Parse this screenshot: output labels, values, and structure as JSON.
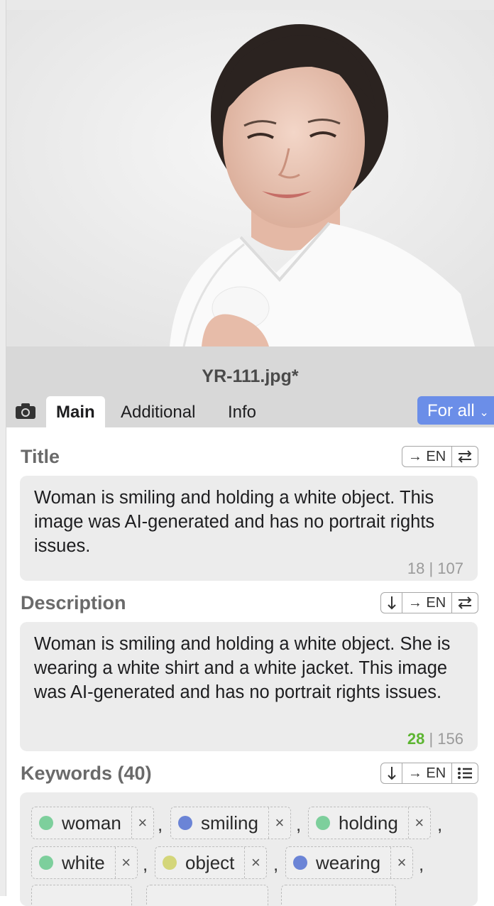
{
  "file": {
    "name": "YR-111.jpg*"
  },
  "tabs": {
    "camera_icon": "camera-icon",
    "main": "Main",
    "additional": "Additional",
    "info": "Info",
    "for_all": "For all"
  },
  "title_section": {
    "label": "Title",
    "translate_label": "→ EN",
    "swap_icon": "swap-icon",
    "text": "Woman is smiling and holding a white object. This image was AI-generated and has no portrait rights issues.",
    "count_used": "18",
    "separator": "|",
    "count_max": "107"
  },
  "description_section": {
    "label": "Description",
    "download_icon": "arrow-down-icon",
    "translate_label": "→ EN",
    "swap_icon": "swap-icon",
    "text": "Woman is smiling and holding a white object. She is wearing a white shirt and a white jacket. This image was AI-generated and has no portrait rights issues.",
    "count_used": "28",
    "separator": "|",
    "count_max": "156"
  },
  "keywords_section": {
    "label": "Keywords (40)",
    "translate_label": "→ EN",
    "list_icon": "list-icon",
    "items": [
      {
        "text": "woman",
        "color": "#7dcf9c"
      },
      {
        "text": "smiling",
        "color": "#6b84d6"
      },
      {
        "text": "holding",
        "color": "#7dcf9c"
      },
      {
        "text": "white",
        "color": "#7dcf9c"
      },
      {
        "text": "object",
        "color": "#d4d67a"
      },
      {
        "text": "wearing",
        "color": "#6b84d6"
      }
    ]
  },
  "colors": {
    "accent": "#6b8ee8",
    "count_ok": "#5cb531"
  }
}
